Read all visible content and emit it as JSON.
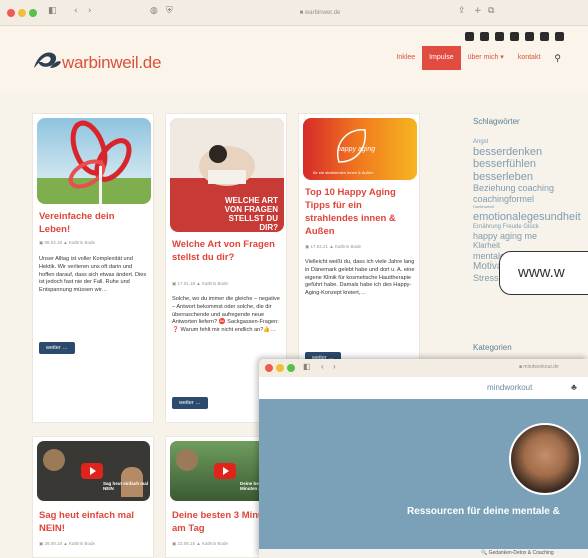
{
  "browser": {
    "url": "■ warbinwer.de",
    "traffic_colors": [
      "#ee5b52",
      "#f2be3a",
      "#57c14a"
    ]
  },
  "site": {
    "logo_text": "warbinweil.de",
    "nav": [
      "Inklee",
      "Impulse",
      "über mich ▾",
      "kontakt"
    ],
    "active_nav": "Impulse"
  },
  "cards": [
    {
      "title": "Vereinfache dein Leben!",
      "meta": "▣ 06.04.18   ▲ Kathrin Bode",
      "text": "Unser Alltag ist voller Komplexität und Hektik. Wir verlieren uns oft darin und hoffen darauf, dass sich etwas ändert. Dies ist jedoch fast nie der Fall. Ruhe und Entspannung müssen wir…",
      "button": "weiter …"
    },
    {
      "title": "Welche Art von Fragen stellst du dir?",
      "image_caption": "WELCHE ART VON FRAGEN STELLST DU DIR?",
      "meta": "▣ 17.01.18   ▲ Kathrin Bode",
      "text": "Solche, wo du immer die gleiche – negative – Antwort bekommst oder solche, die dir überraschende und aufregende neue Antworten liefern? ⛔ Sackgassen-Fragen: ❓ Warum fehlt mir nicht endlich an?👍…",
      "button": "weiter …"
    },
    {
      "title": "Top 10 Happy Aging Tipps für ein strahlendes innen & Außen",
      "image_caption": "happy aging",
      "image_subcaption": "für ein strahlendes Innen & Außen",
      "meta": "▣ 17.04.21   ▲ Kathrin Bode",
      "text": "Vielleicht weißt du, dass ich viele Jahre lang in Dänemark gelebt habe und dort u. A. eine eigene Klinik für kosmetische Hauttherapie geführt habe. Damals habe ich des Happy-Aging-Konzept kreiert,…",
      "button": "weiter …"
    },
    {
      "title": "Sag heut einfach mal NEIN!",
      "video_caption": "Sag heut einfach mal NEIN",
      "meta": "▣ 28.08.18   ▲ Kathrin Bode"
    },
    {
      "title": "Deine besten 3 Minuten am Tag",
      "video_caption": "Deine besten 3 Minuten am Tag",
      "meta": "▣ 23.08.18   ▲ Kathrin Bode"
    }
  ],
  "sidebar": {
    "tags_heading": "Schlagwörter",
    "tags": [
      {
        "text": "Angst",
        "size": 6
      },
      {
        "text": "besserdenken",
        "size": 11
      },
      {
        "text": "besserfühlen",
        "size": 11
      },
      {
        "text": "besserleben",
        "size": 11
      },
      {
        "text": "Beziehung coaching",
        "size": 9
      },
      {
        "text": "coachingformel",
        "size": 9
      },
      {
        "text": "Dankbarkeit",
        "size": 4
      },
      {
        "text": "emotionalegesundheit",
        "size": 11
      },
      {
        "text": "Ernährung Freude Glück",
        "size": 6
      },
      {
        "text": "happy aging me",
        "size": 9
      },
      {
        "text": "Klarheit",
        "size": 8
      },
      {
        "text": "mentale",
        "size": 9
      },
      {
        "text": "Motivation",
        "size": 10
      },
      {
        "text": "Stress Ziele",
        "size": 9
      }
    ],
    "categories_heading": "Kategorien"
  },
  "overlay": {
    "url_bubble": "www.w"
  },
  "second_window": {
    "url": "■ mindworkout.de",
    "logo": "mindworkout",
    "hero_title": "Ressourcen für deine mentale &",
    "footer": "🔍 Gedanken-Detox & Coaching"
  }
}
